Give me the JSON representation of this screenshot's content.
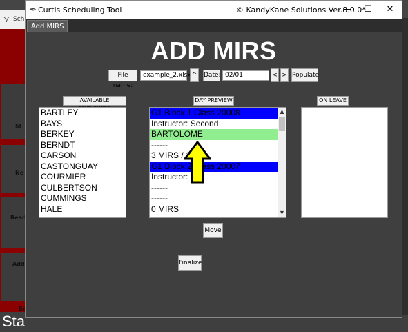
{
  "background_app": {
    "title_fragment": "Sche",
    "sidebar_tiles": [
      "Sl",
      "Ne",
      "Read",
      "Add",
      "Sc"
    ],
    "status_text": "Sta"
  },
  "window": {
    "title": "Curtis Scheduling Tool",
    "company": "© KandyKane Solutions  Ver.8.0.0*",
    "controls": {
      "minimize": "—",
      "maximize": "☐",
      "close": "✕"
    }
  },
  "tab": {
    "label": "Add MIRS"
  },
  "heading": "ADD MIRS",
  "toolbar": {
    "file_name_label": "File name:",
    "file_name_value": "example_2.xlsx",
    "up_label": "^",
    "date_label": "Date:",
    "date_value": "02/01",
    "prev_label": "<",
    "next_label": ">",
    "populate_label": "Populate"
  },
  "columns": {
    "available": {
      "label": "AVAILABLE EMPLOYESS",
      "items": [
        "BARTLEY",
        "BAYS",
        "BERKEY",
        "BERNDT",
        "CARSON",
        "CASTONGUAY",
        "COURMIER",
        "CULBERTSON",
        "CUMMINGS",
        "HALE"
      ]
    },
    "preview": {
      "label": "DAY PREVIEW",
      "items": [
        {
          "text": "G1  Block:1 Class 20008",
          "style": "blue"
        },
        {
          "text": "Instructor: Second",
          "style": ""
        },
        {
          "text": "BARTOLOME",
          "style": "green"
        },
        {
          "text": "------",
          "style": ""
        },
        {
          "text": "3 MIRS / 1   RS",
          "style": ""
        },
        {
          "text": "G1  Block:2 Class 20007",
          "style": "blue"
        },
        {
          "text": "Instructor: N",
          "style": ""
        },
        {
          "text": "------",
          "style": ""
        },
        {
          "text": "------",
          "style": ""
        },
        {
          "text": "0 MIRS",
          "style": ""
        }
      ]
    },
    "on_leave": {
      "label": "ON LEAVE",
      "items": []
    }
  },
  "buttons": {
    "move": "Move",
    "finalize": "Finalize"
  },
  "icons": {
    "scroll_up": "▲",
    "scroll_down": "▼",
    "window_icon": "feather-icon"
  },
  "colors": {
    "arrow_fill": "#ffff00",
    "highlight_blue": "#0000ff",
    "highlight_green": "#90ee90",
    "sidebar_red": "#8b0000"
  }
}
